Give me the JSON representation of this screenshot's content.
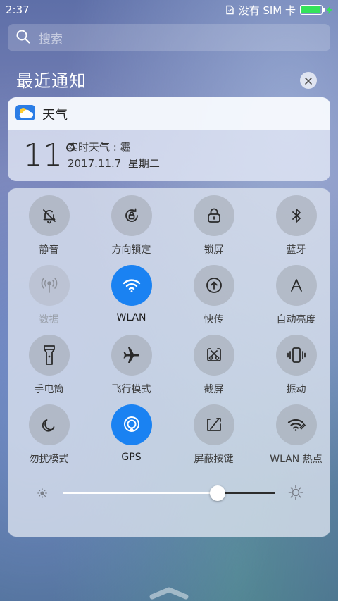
{
  "status_bar": {
    "time": "2:37",
    "sim_text": "没有 SIM 卡",
    "battery_level": 0.95,
    "battery_color": "#34e35a"
  },
  "search": {
    "placeholder": "搜索",
    "icon": "search-icon"
  },
  "notifications": {
    "title": "最近通知",
    "clear_icon": "close-icon",
    "weather": {
      "app_name": "天气",
      "icon": "weather-cloud-icon",
      "temperature": "11°",
      "condition": "实时天气 : 霾",
      "date": "2017.11.7  星期二"
    }
  },
  "quick_settings": {
    "accent_color": "#1a82f2",
    "tiles": [
      {
        "label": "静音",
        "icon": "bell-off-icon",
        "state": "off"
      },
      {
        "label": "方向锁定",
        "icon": "rotation-lock-icon",
        "state": "off"
      },
      {
        "label": "锁屏",
        "icon": "lock-icon",
        "state": "off"
      },
      {
        "label": "蓝牙",
        "icon": "bluetooth-icon",
        "state": "off"
      },
      {
        "label": "数据",
        "icon": "mobile-data-icon",
        "state": "disabled"
      },
      {
        "label": "WLAN",
        "icon": "wifi-icon",
        "state": "on"
      },
      {
        "label": "快传",
        "icon": "quick-transfer-icon",
        "state": "off"
      },
      {
        "label": "自动亮度",
        "icon": "auto-brightness-icon",
        "state": "off"
      },
      {
        "label": "手电筒",
        "icon": "flashlight-icon",
        "state": "off"
      },
      {
        "label": "飞行模式",
        "icon": "airplane-icon",
        "state": "off"
      },
      {
        "label": "截屏",
        "icon": "screenshot-icon",
        "state": "off"
      },
      {
        "label": "振动",
        "icon": "vibrate-icon",
        "state": "off"
      },
      {
        "label": "勿扰模式",
        "icon": "moon-icon",
        "state": "off"
      },
      {
        "label": "GPS",
        "icon": "gps-icon",
        "state": "on"
      },
      {
        "label": "屏蔽按键",
        "icon": "block-keys-icon",
        "state": "off"
      },
      {
        "label": "WLAN 热点",
        "icon": "hotspot-icon",
        "state": "off"
      }
    ],
    "brightness": {
      "level": 0.73,
      "low_icon": "brightness-low-icon",
      "high_icon": "brightness-high-icon"
    }
  }
}
